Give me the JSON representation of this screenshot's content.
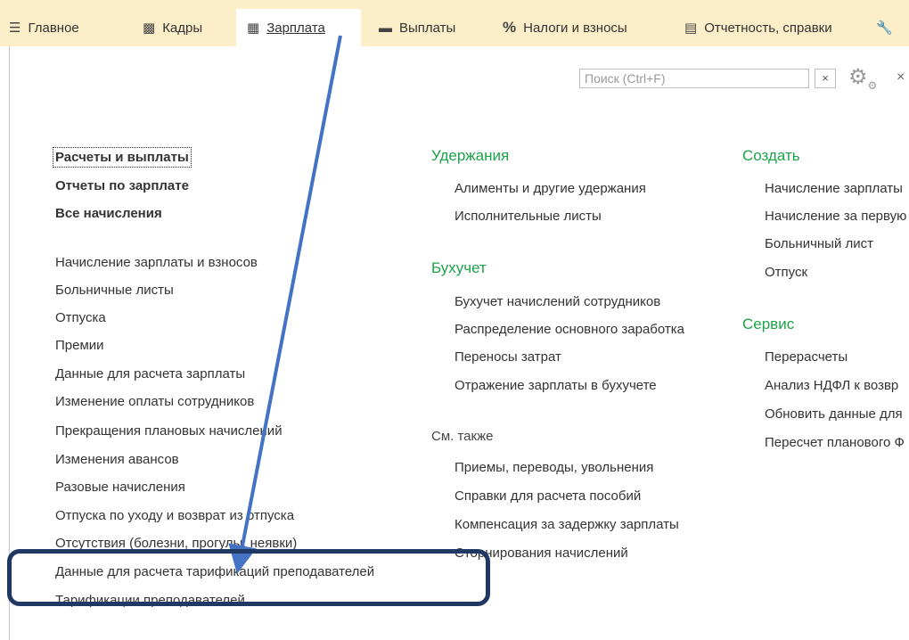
{
  "sections": [
    {
      "label": "Главное",
      "icon": "menu-icon"
    },
    {
      "label": "Кадры",
      "icon": "people-icon"
    },
    {
      "label": "Зарплата",
      "icon": "calculator-icon",
      "active": true
    },
    {
      "label": "Выплаты",
      "icon": "wallet-icon"
    },
    {
      "label": "Налоги и взносы",
      "icon": "percent-icon"
    },
    {
      "label": "Отчетность, справки",
      "icon": "report-icon"
    },
    {
      "label": "",
      "icon": "wrench-icon"
    }
  ],
  "search": {
    "placeholder": "Поиск (Ctrl+F)",
    "clear": "×"
  },
  "close_glyph": "×",
  "col1": {
    "top_links": [
      "Расчеты и выплаты",
      "Отчеты по зарплате",
      "Все начисления"
    ],
    "links": [
      "Начисление зарплаты и взносов",
      "Больничные листы",
      "Отпуска",
      "Премии",
      "Данные для расчета зарплаты",
      "Изменение оплаты сотрудников",
      "Прекращения плановых начислений",
      "Изменения авансов",
      "Разовые начисления",
      "Отпуска по уходу и возврат из отпуска",
      "Отсутствия (болезни, прогулы, неявки)",
      "Данные для расчета тарификаций преподавателей",
      "Тарификации преподавателей"
    ]
  },
  "col2": {
    "uderzhaniya_title": "Удержания",
    "uderzhaniya": [
      "Алименты и другие удержания",
      "Исполнительные листы"
    ],
    "buhuchet_title": "Бухучет",
    "buhuchet": [
      "Бухучет начислений сотрудников",
      "Распределение основного заработка",
      "Переносы затрат",
      "Отражение зарплаты в бухучете"
    ],
    "see_also_title": "См. также",
    "see_also": [
      "Приемы, переводы, увольнения",
      "Справки для расчета пособий",
      "Компенсация за задержку зарплаты",
      "Сторнирования начислений"
    ]
  },
  "col3": {
    "create_title": "Создать",
    "create": [
      "Начисление зарплаты",
      "Начисление за первую",
      "Больничный лист",
      "Отпуск"
    ],
    "service_title": "Сервис",
    "service": [
      "Перерасчеты",
      "Анализ НДФЛ к возвр",
      "Обновить данные для",
      "Пересчет планового Ф"
    ]
  },
  "colors": {
    "topbar": "#fbeec8",
    "group_title": "#1ca34a",
    "arrow": "#4472c4",
    "highlight": "#1f3864"
  }
}
